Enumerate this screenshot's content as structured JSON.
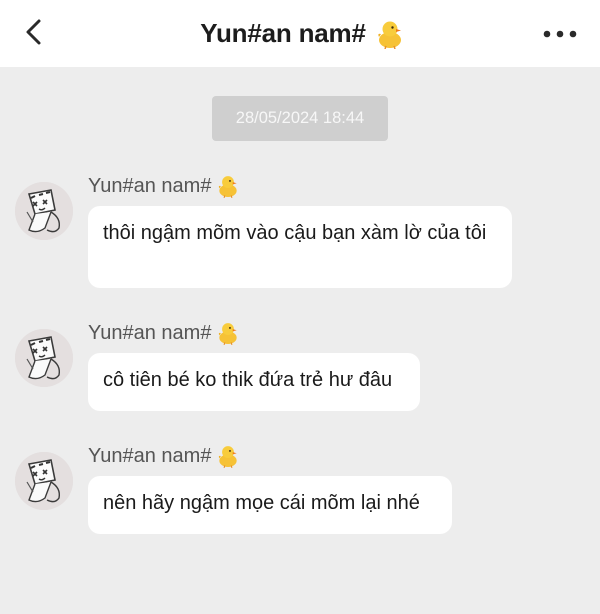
{
  "header": {
    "title": "Yun#an nam#",
    "back_icon": "chevron-left-icon",
    "more_icon": "more-horizontal-icon",
    "title_icon": "chick-emoji-icon"
  },
  "timestamp": "28/05/2024 18:44",
  "messages": [
    {
      "sender": "Yun#an nam#",
      "text": "thôi ngậm mõm vào cậu bạn xàm lờ của tôi"
    },
    {
      "sender": "Yun#an nam#",
      "text": "cô tiên bé ko thik đứa trẻ hư đâu"
    },
    {
      "sender": "Yun#an nam#",
      "text": "nên hãy ngậm mọe cái mõm lại nhé"
    }
  ],
  "colors": {
    "background": "#ededed",
    "header": "#ffffff",
    "bubble": "#ffffff",
    "timestamp_bg": "#cfcfcf"
  }
}
